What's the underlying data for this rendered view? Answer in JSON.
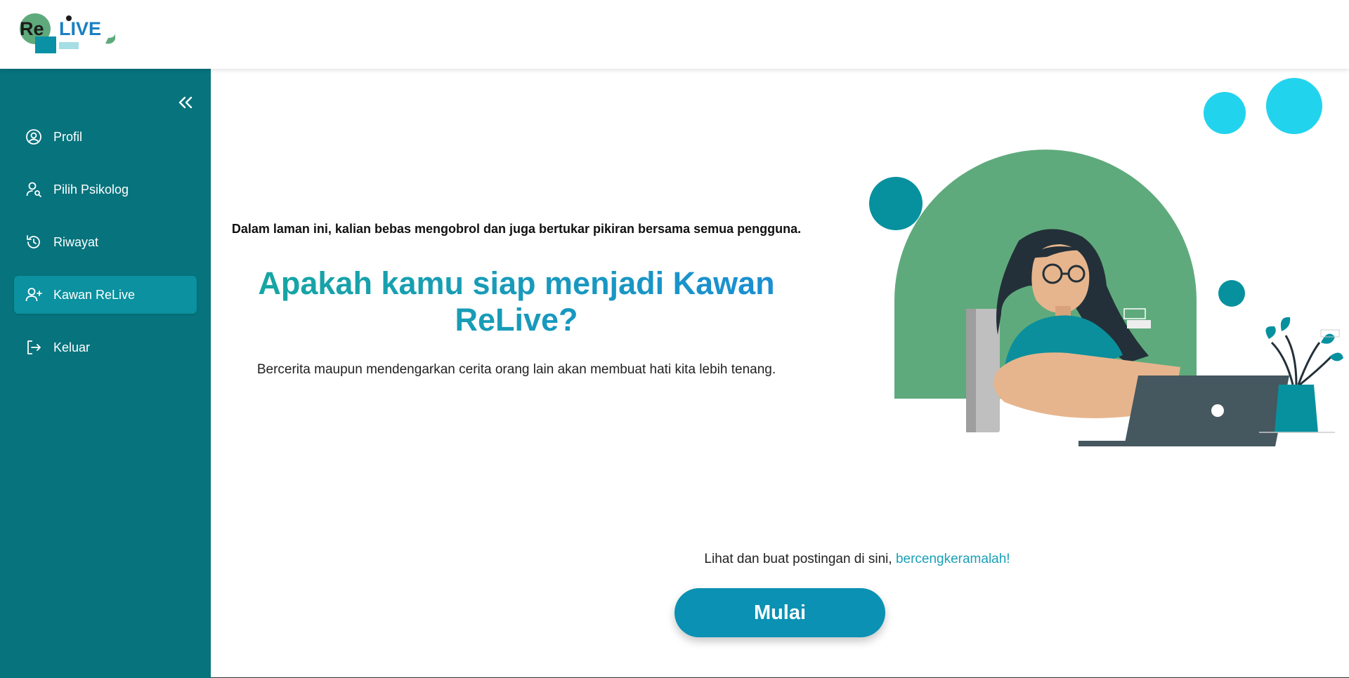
{
  "header": {
    "logo_text_re": "Re",
    "logo_text_live": "LIVE"
  },
  "sidebar": {
    "items": [
      {
        "label": "Profil",
        "icon": "user-circle-icon"
      },
      {
        "label": "Pilih Psikolog",
        "icon": "user-search-icon"
      },
      {
        "label": "Riwayat",
        "icon": "history-icon"
      },
      {
        "label": "Kawan ReLive",
        "icon": "user-plus-icon",
        "active": true
      },
      {
        "label": "Keluar",
        "icon": "logout-icon"
      }
    ]
  },
  "main": {
    "intro": "Dalam laman ini, kalian bebas mengobrol dan juga bertukar pikiran bersama semua pengguna.",
    "headline": "Apakah kamu siap menjadi Kawan ReLive?",
    "subtext": "Bercerita maupun mendengarkan cerita orang lain akan membuat hati kita lebih tenang.",
    "cta_prefix": "Lihat dan buat postingan di sini, ",
    "cta_link": "bercengkeramalah!",
    "start_label": "Mulai"
  },
  "colors": {
    "sidebar": "#07737d",
    "sidebar_active": "#0b919f",
    "accent": "#0a91b3",
    "green": "#5faa7c",
    "cyan": "#22d3ee"
  }
}
